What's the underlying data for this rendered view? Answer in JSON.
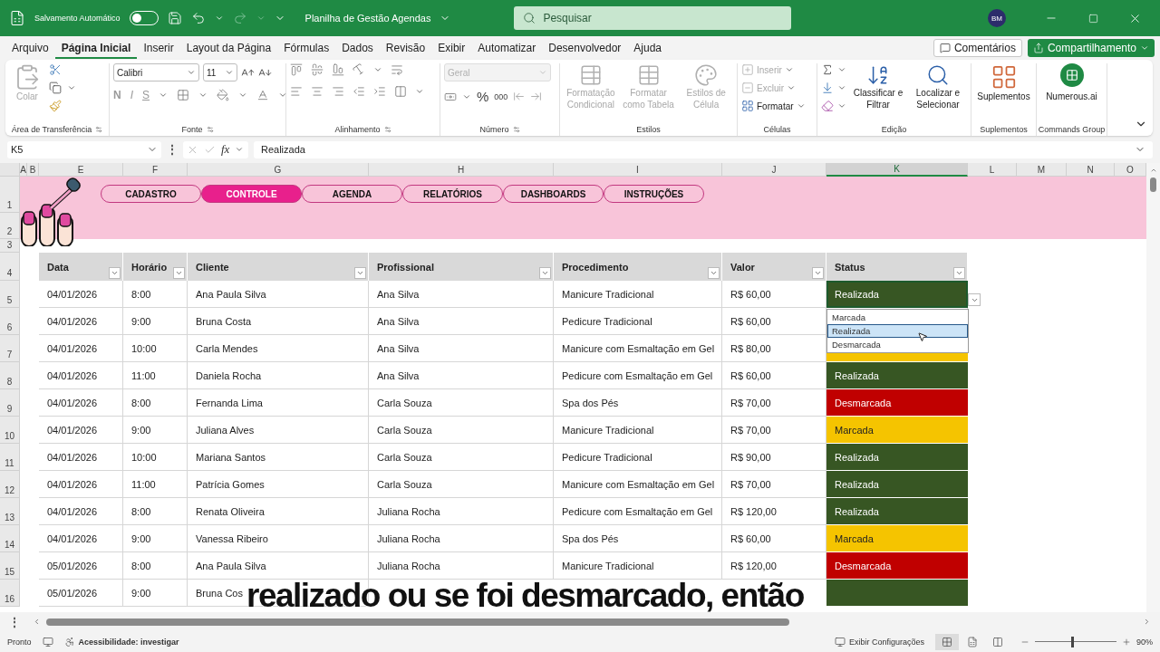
{
  "titlebar": {
    "autosave_label": "Salvamento Automático",
    "autosave_on": false,
    "document_title": "Planilha de Gestão Agendas",
    "search_placeholder": "Pesquisar",
    "avatar": "BM"
  },
  "menu": {
    "tabs": [
      {
        "label": "Arquivo",
        "selected": false
      },
      {
        "label": "Página Inicial",
        "selected": true
      },
      {
        "label": "Inserir",
        "selected": false
      },
      {
        "label": "Layout da Página",
        "selected": false
      },
      {
        "label": "Fórmulas",
        "selected": false
      },
      {
        "label": "Dados",
        "selected": false
      },
      {
        "label": "Revisão",
        "selected": false
      },
      {
        "label": "Exibir",
        "selected": false
      },
      {
        "label": "Automatizar",
        "selected": false
      },
      {
        "label": "Desenvolvedor",
        "selected": false
      },
      {
        "label": "Ajuda",
        "selected": false
      }
    ],
    "comments": "Comentários",
    "share": "Compartilhamento"
  },
  "ribbon": {
    "groups": [
      {
        "kind": "clipboard",
        "title": "Área de Transferência",
        "tools": [
          {
            "label": "Colar",
            "disabled": true
          }
        ]
      },
      {
        "kind": "font",
        "title": "Fonte",
        "font": "Calibri",
        "size": "11",
        "tools": [
          {
            "label": "N",
            "disabled": true
          },
          {
            "label": "I",
            "disabled": true
          },
          {
            "label": "S",
            "disabled": true
          }
        ]
      },
      {
        "kind": "alignment",
        "title": "Alinhamento"
      },
      {
        "kind": "number",
        "title": "Número",
        "format": "Geral",
        "tools": [
          {
            "label": "%",
            "disabled": false
          },
          {
            "label": "000",
            "disabled": false
          }
        ]
      },
      {
        "kind": "styles",
        "title": "Estilos",
        "tools": [
          {
            "label": "Formatação Condicional",
            "disabled": true
          },
          {
            "label": "Formatar como Tabela",
            "disabled": true
          },
          {
            "label": "Estilos de Célula",
            "disabled": true
          }
        ]
      },
      {
        "kind": "cells",
        "title": "Células",
        "tools": [
          {
            "label": "Inserir",
            "disabled": true
          },
          {
            "label": "Excluir",
            "disabled": true
          },
          {
            "label": "Formatar",
            "disabled": false
          }
        ]
      },
      {
        "kind": "editing",
        "title": "Edição",
        "tools": [
          {
            "label": "Classificar e Filtrar",
            "disabled": false
          },
          {
            "label": "Localizar e Selecionar",
            "disabled": false
          }
        ]
      },
      {
        "kind": "addins",
        "title": "Suplementos",
        "tools": [
          {
            "label": "Suplementos",
            "disabled": false
          }
        ]
      },
      {
        "kind": "commands",
        "title": "Commands Group",
        "tools": [
          {
            "label": "Numerous.ai",
            "disabled": false
          }
        ]
      }
    ]
  },
  "formula_bar": {
    "name_box": "K5",
    "more": "⋮",
    "fx": "fx",
    "formula": "Realizada"
  },
  "sheet": {
    "left_columns": [
      {
        "label": "A",
        "selected": false
      },
      {
        "label": "B",
        "selected": false
      }
    ],
    "columns": [
      {
        "label": "E",
        "selected": false
      },
      {
        "label": "F",
        "selected": false
      },
      {
        "label": "G",
        "selected": false
      },
      {
        "label": "H",
        "selected": false
      },
      {
        "label": "I",
        "selected": false
      },
      {
        "label": "J",
        "selected": false
      },
      {
        "label": "K",
        "selected": true
      },
      {
        "label": "L",
        "selected": false
      },
      {
        "label": "M",
        "selected": false
      },
      {
        "label": "N",
        "selected": false
      },
      {
        "label": "O",
        "selected": false
      }
    ],
    "top_rows": [
      "1",
      "2",
      "3",
      "4"
    ],
    "nav": [
      {
        "label": "CADASTRO",
        "selected": false
      },
      {
        "label": "CONTROLE",
        "selected": true
      },
      {
        "label": "AGENDA",
        "selected": false
      },
      {
        "label": "RELATÓRIOS",
        "selected": false
      },
      {
        "label": "DASHBOARDS",
        "selected": false
      },
      {
        "label": "INSTRUÇÕES",
        "selected": false
      }
    ],
    "table_headers": [
      "Data",
      "Horário",
      "Cliente",
      "Profissional",
      "Procedimento",
      "Valor",
      "Status"
    ],
    "rows": [
      {
        "row": "5",
        "cells": [
          "04/01/2026",
          "8:00",
          "Ana Paula Silva",
          "Ana Silva",
          "Manicure Tradicional",
          "R$ 60,00"
        ],
        "status": "Realizada",
        "color": "#375623",
        "selected": true
      },
      {
        "row": "6",
        "cells": [
          "04/01/2026",
          "9:00",
          "Bruna Costa",
          "Ana Silva",
          "Pedicure Tradicional",
          "R$ 60,00"
        ],
        "selected": false
      },
      {
        "row": "7",
        "cells": [
          "04/01/2026",
          "10:00",
          "Carla Mendes",
          "Ana Silva",
          "Manicure com Esmaltação em Gel",
          "R$ 80,00"
        ],
        "color": "#f5c400",
        "selected": false
      },
      {
        "row": "8",
        "cells": [
          "04/01/2026",
          "11:00",
          "Daniela Rocha",
          "Ana Silva",
          "Pedicure com Esmaltação em Gel",
          "R$ 60,00"
        ],
        "status": "Realizada",
        "color": "#375623",
        "selected": false
      },
      {
        "row": "9",
        "cells": [
          "04/01/2026",
          "8:00",
          "Fernanda Lima",
          "Carla Souza",
          "Spa dos Pés",
          "R$ 70,00"
        ],
        "status": "Desmarcada",
        "color": "#c00000",
        "selected": false
      },
      {
        "row": "10",
        "cells": [
          "04/01/2026",
          "9:00",
          "Juliana Alves",
          "Carla Souza",
          "Manicure Tradicional",
          "R$ 70,00"
        ],
        "status": "Marcada",
        "color": "#f5c400",
        "selected": false
      },
      {
        "row": "11",
        "cells": [
          "04/01/2026",
          "10:00",
          "Mariana Santos",
          "Carla Souza",
          "Pedicure Tradicional",
          "R$ 90,00"
        ],
        "status": "Realizada",
        "color": "#375623",
        "selected": false
      },
      {
        "row": "12",
        "cells": [
          "04/01/2026",
          "11:00",
          "Patrícia Gomes",
          "Carla Souza",
          "Manicure com Esmaltação em Gel",
          "R$ 70,00"
        ],
        "status": "Realizada",
        "color": "#375623",
        "selected": false
      },
      {
        "row": "13",
        "cells": [
          "04/01/2026",
          "8:00",
          "Renata Oliveira",
          "Juliana Rocha",
          "Pedicure com Esmaltação em Gel",
          "R$ 120,00"
        ],
        "status": "Realizada",
        "color": "#375623",
        "selected": false
      },
      {
        "row": "14",
        "cells": [
          "04/01/2026",
          "9:00",
          "Vanessa Ribeiro",
          "Juliana Rocha",
          "Spa dos Pés",
          "R$ 60,00"
        ],
        "status": "Marcada",
        "color": "#f5c400",
        "selected": false
      },
      {
        "row": "15",
        "cells": [
          "05/01/2026",
          "8:00",
          "Ana Paula Silva",
          "Juliana Rocha",
          "Manicure Tradicional",
          "R$ 120,00"
        ],
        "status": "Desmarcada",
        "color": "#c00000",
        "selected": false
      },
      {
        "row": "16",
        "cells": [
          "05/01/2026",
          "9:00",
          "Bruna Cos"
        ],
        "color": "#375623",
        "selected": false
      }
    ],
    "dropdown": [
      {
        "label": "Marcada",
        "selected": false
      },
      {
        "label": "Realizada",
        "selected": true
      },
      {
        "label": "Desmarcada",
        "selected": false
      }
    ]
  },
  "caption": "realizado ou se foi desmarcado, então",
  "status_bar": {
    "more": "⋮",
    "ready": "Pronto",
    "accessibility": "Acessibilidade: investigar",
    "display_settings": "Exibir Configurações",
    "views": [
      {
        "kind": "normal",
        "selected": true
      },
      {
        "kind": "page-layout",
        "selected": false
      },
      {
        "kind": "page-break",
        "selected": false
      }
    ],
    "zoom": {
      "level": 0.45,
      "reading": "90%"
    }
  }
}
